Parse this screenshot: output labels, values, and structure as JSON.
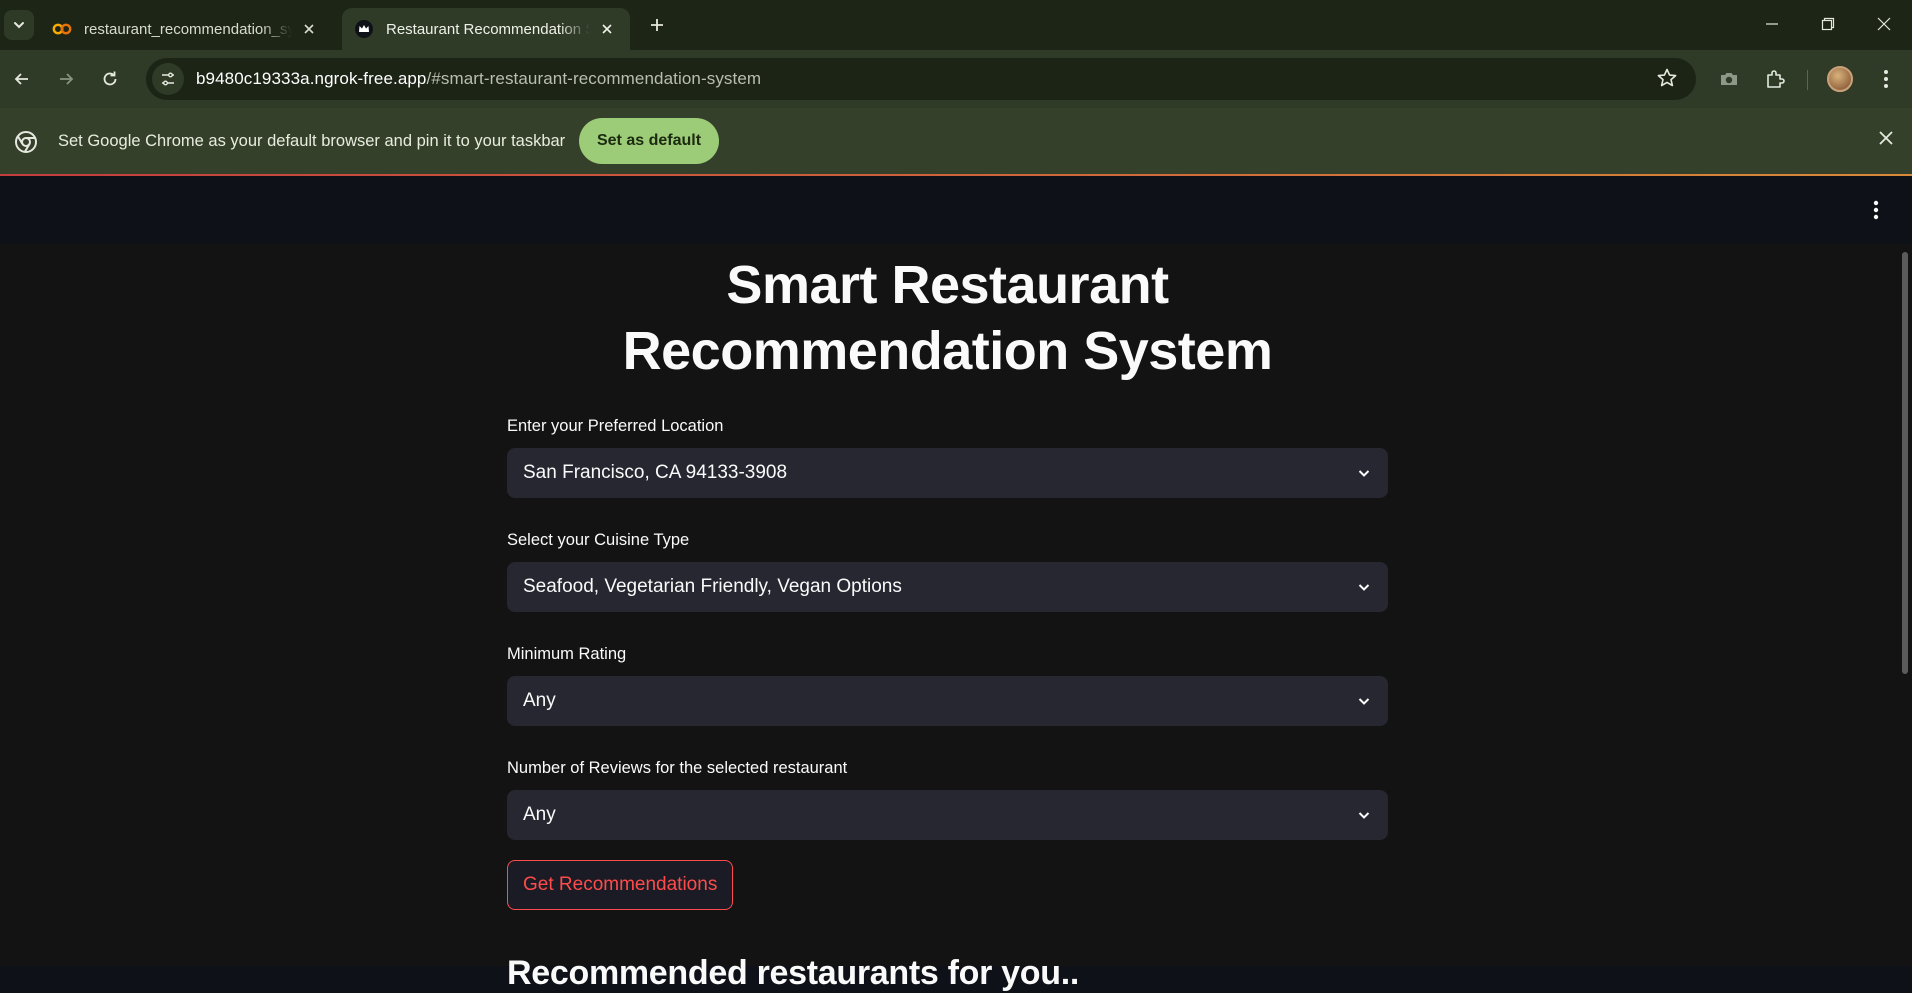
{
  "browser": {
    "tabs": [
      {
        "title": "restaurant_recommendation_sy",
        "favicon": "colab-icon",
        "active": false
      },
      {
        "title": "Restaurant Recommendation Sy",
        "favicon": "crown-icon",
        "active": true
      }
    ],
    "url_host": "b9480c19333a.ngrok-free.app",
    "url_path": "/#smart-restaurant-recommendation-system",
    "infobar_message": "Set Google Chrome as your default browser and pin it to your taskbar",
    "infobar_button": "Set as default"
  },
  "app": {
    "title": "Smart Restaurant Recommendation System",
    "fields": [
      {
        "label": "Enter your Preferred Location",
        "value": "San Francisco, CA 94133-3908"
      },
      {
        "label": "Select your Cuisine Type",
        "value": "Seafood, Vegetarian Friendly, Vegan Options"
      },
      {
        "label": "Minimum Rating",
        "value": "Any"
      },
      {
        "label": "Number of Reviews for the selected restaurant",
        "value": "Any"
      }
    ],
    "button_label": "Get Recommendations",
    "results_heading": "Recommended restaurants for you.."
  },
  "colors": {
    "accent": "#ff4b4b",
    "select_bg": "#262730",
    "app_bg": "#131313",
    "chrome_bar": "#2f3a27"
  }
}
